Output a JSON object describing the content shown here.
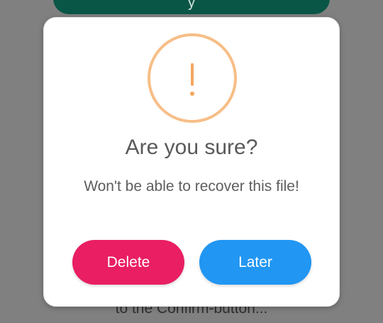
{
  "background": {
    "hint_text": "to the Confirm-button...",
    "top_button_label": "y"
  },
  "dialog": {
    "icon": "exclamation-icon",
    "icon_color": "#f7be87",
    "title": "Are you sure?",
    "message": "Won't be able to recover this file!",
    "buttons": {
      "delete_label": "Delete",
      "delete_color": "#e91e63",
      "later_label": "Later",
      "later_color": "#2196f3"
    }
  }
}
